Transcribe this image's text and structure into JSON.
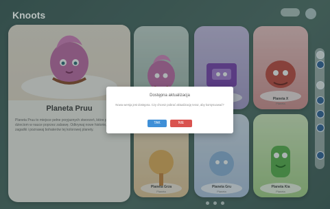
{
  "app": {
    "brand": "Knoots"
  },
  "featured_card": {
    "title": "Planeta Pruu",
    "description": "Planeta Pruu to miejsce pełne przyjaznych stworzeń, które pomagają dzieciom w nauce poprzez zabawę. Odkrywaj nowe historie, rozwiązuj zagadki i poznawaj bohaterów tej kolorowej planety."
  },
  "grid_cards": [
    {
      "label": "",
      "sub": ""
    },
    {
      "label": "",
      "sub": ""
    },
    {
      "label": "Planeta X",
      "sub": "Planeta"
    },
    {
      "label": "Planeta Grza",
      "sub": "Planeta"
    },
    {
      "label": "Planeta Gru",
      "sub": "Planeta"
    },
    {
      "label": "Planeta Kia",
      "sub": "Planeta"
    }
  ],
  "modal": {
    "title": "Dostępna aktualizacja",
    "message": "Nowa wersja jest dostępna. Czy chcesz pobrać aktualizację teraz, aby kontynuować?",
    "yes_label": "TAK",
    "no_label": "NIE"
  },
  "colors": {
    "accent_blue": "#3f8fd7",
    "danger_red": "#d9534f",
    "background_green": "#4f7067"
  }
}
